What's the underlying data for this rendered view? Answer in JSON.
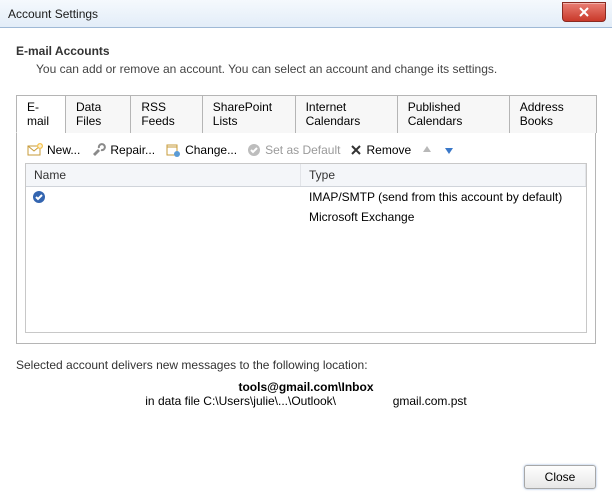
{
  "window": {
    "title": "Account Settings"
  },
  "close_icon": "x",
  "header": {
    "title": "E-mail Accounts",
    "desc": "You can add or remove an account. You can select an account and change its settings."
  },
  "tabs": [
    "E-mail",
    "Data Files",
    "RSS Feeds",
    "SharePoint Lists",
    "Internet Calendars",
    "Published Calendars",
    "Address Books"
  ],
  "toolbar": {
    "new": "New...",
    "repair": "Repair...",
    "change": "Change...",
    "set_default": "Set as Default",
    "remove": "Remove"
  },
  "grid": {
    "columns": {
      "name": "Name",
      "type": "Type"
    },
    "rows": [
      {
        "name": "",
        "type": "IMAP/SMTP (send from this account by default)",
        "default": true
      },
      {
        "name": "",
        "type": "Microsoft Exchange",
        "default": false
      }
    ]
  },
  "footer": {
    "line1": "Selected account delivers new messages to the following location:",
    "folder": "tools@gmail.com\\Inbox",
    "path_prefix": "in data file C:\\Users\\julie\\...\\Outlook\\",
    "path_suffix": "gmail.com.pst"
  },
  "buttons": {
    "close": "Close"
  }
}
